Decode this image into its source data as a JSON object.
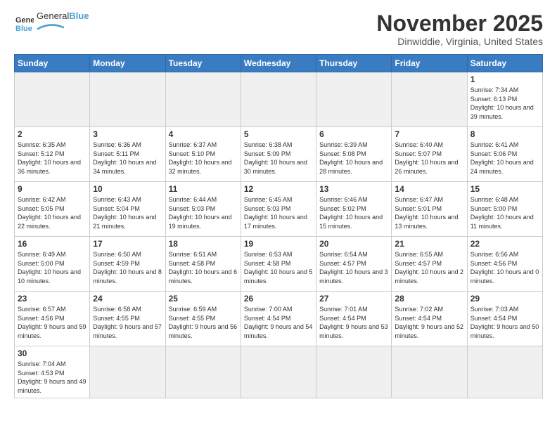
{
  "logo": {
    "text_general": "General",
    "text_blue": "Blue"
  },
  "title": "November 2025",
  "location": "Dinwiddie, Virginia, United States",
  "weekdays": [
    "Sunday",
    "Monday",
    "Tuesday",
    "Wednesday",
    "Thursday",
    "Friday",
    "Saturday"
  ],
  "weeks": [
    [
      {
        "day": "",
        "info": ""
      },
      {
        "day": "",
        "info": ""
      },
      {
        "day": "",
        "info": ""
      },
      {
        "day": "",
        "info": ""
      },
      {
        "day": "",
        "info": ""
      },
      {
        "day": "",
        "info": ""
      },
      {
        "day": "1",
        "info": "Sunrise: 7:34 AM\nSunset: 6:13 PM\nDaylight: 10 hours\nand 39 minutes."
      }
    ],
    [
      {
        "day": "2",
        "info": "Sunrise: 6:35 AM\nSunset: 5:12 PM\nDaylight: 10 hours\nand 36 minutes."
      },
      {
        "day": "3",
        "info": "Sunrise: 6:36 AM\nSunset: 5:11 PM\nDaylight: 10 hours\nand 34 minutes."
      },
      {
        "day": "4",
        "info": "Sunrise: 6:37 AM\nSunset: 5:10 PM\nDaylight: 10 hours\nand 32 minutes."
      },
      {
        "day": "5",
        "info": "Sunrise: 6:38 AM\nSunset: 5:09 PM\nDaylight: 10 hours\nand 30 minutes."
      },
      {
        "day": "6",
        "info": "Sunrise: 6:39 AM\nSunset: 5:08 PM\nDaylight: 10 hours\nand 28 minutes."
      },
      {
        "day": "7",
        "info": "Sunrise: 6:40 AM\nSunset: 5:07 PM\nDaylight: 10 hours\nand 26 minutes."
      },
      {
        "day": "8",
        "info": "Sunrise: 6:41 AM\nSunset: 5:06 PM\nDaylight: 10 hours\nand 24 minutes."
      }
    ],
    [
      {
        "day": "9",
        "info": "Sunrise: 6:42 AM\nSunset: 5:05 PM\nDaylight: 10 hours\nand 22 minutes."
      },
      {
        "day": "10",
        "info": "Sunrise: 6:43 AM\nSunset: 5:04 PM\nDaylight: 10 hours\nand 21 minutes."
      },
      {
        "day": "11",
        "info": "Sunrise: 6:44 AM\nSunset: 5:03 PM\nDaylight: 10 hours\nand 19 minutes."
      },
      {
        "day": "12",
        "info": "Sunrise: 6:45 AM\nSunset: 5:03 PM\nDaylight: 10 hours\nand 17 minutes."
      },
      {
        "day": "13",
        "info": "Sunrise: 6:46 AM\nSunset: 5:02 PM\nDaylight: 10 hours\nand 15 minutes."
      },
      {
        "day": "14",
        "info": "Sunrise: 6:47 AM\nSunset: 5:01 PM\nDaylight: 10 hours\nand 13 minutes."
      },
      {
        "day": "15",
        "info": "Sunrise: 6:48 AM\nSunset: 5:00 PM\nDaylight: 10 hours\nand 11 minutes."
      }
    ],
    [
      {
        "day": "16",
        "info": "Sunrise: 6:49 AM\nSunset: 5:00 PM\nDaylight: 10 hours\nand 10 minutes."
      },
      {
        "day": "17",
        "info": "Sunrise: 6:50 AM\nSunset: 4:59 PM\nDaylight: 10 hours\nand 8 minutes."
      },
      {
        "day": "18",
        "info": "Sunrise: 6:51 AM\nSunset: 4:58 PM\nDaylight: 10 hours\nand 6 minutes."
      },
      {
        "day": "19",
        "info": "Sunrise: 6:53 AM\nSunset: 4:58 PM\nDaylight: 10 hours\nand 5 minutes."
      },
      {
        "day": "20",
        "info": "Sunrise: 6:54 AM\nSunset: 4:57 PM\nDaylight: 10 hours\nand 3 minutes."
      },
      {
        "day": "21",
        "info": "Sunrise: 6:55 AM\nSunset: 4:57 PM\nDaylight: 10 hours\nand 2 minutes."
      },
      {
        "day": "22",
        "info": "Sunrise: 6:56 AM\nSunset: 4:56 PM\nDaylight: 10 hours\nand 0 minutes."
      }
    ],
    [
      {
        "day": "23",
        "info": "Sunrise: 6:57 AM\nSunset: 4:56 PM\nDaylight: 9 hours\nand 59 minutes."
      },
      {
        "day": "24",
        "info": "Sunrise: 6:58 AM\nSunset: 4:55 PM\nDaylight: 9 hours\nand 57 minutes."
      },
      {
        "day": "25",
        "info": "Sunrise: 6:59 AM\nSunset: 4:55 PM\nDaylight: 9 hours\nand 56 minutes."
      },
      {
        "day": "26",
        "info": "Sunrise: 7:00 AM\nSunset: 4:54 PM\nDaylight: 9 hours\nand 54 minutes."
      },
      {
        "day": "27",
        "info": "Sunrise: 7:01 AM\nSunset: 4:54 PM\nDaylight: 9 hours\nand 53 minutes."
      },
      {
        "day": "28",
        "info": "Sunrise: 7:02 AM\nSunset: 4:54 PM\nDaylight: 9 hours\nand 52 minutes."
      },
      {
        "day": "29",
        "info": "Sunrise: 7:03 AM\nSunset: 4:54 PM\nDaylight: 9 hours\nand 50 minutes."
      }
    ],
    [
      {
        "day": "30",
        "info": "Sunrise: 7:04 AM\nSunset: 4:53 PM\nDaylight: 9 hours\nand 49 minutes."
      },
      {
        "day": "",
        "info": ""
      },
      {
        "day": "",
        "info": ""
      },
      {
        "day": "",
        "info": ""
      },
      {
        "day": "",
        "info": ""
      },
      {
        "day": "",
        "info": ""
      },
      {
        "day": "",
        "info": ""
      }
    ]
  ]
}
